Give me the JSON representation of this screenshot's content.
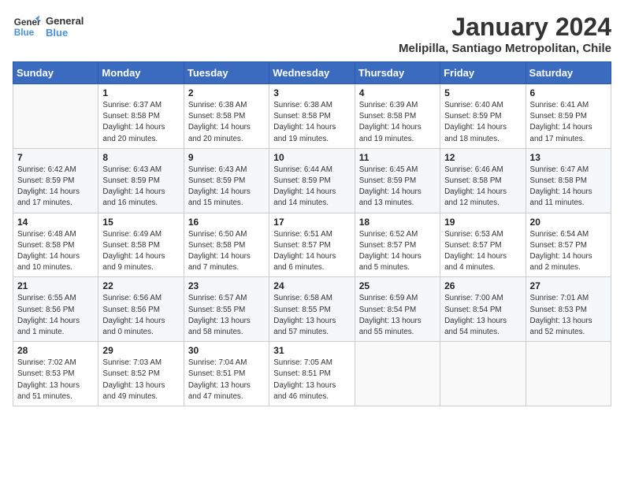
{
  "header": {
    "logo_general": "General",
    "logo_blue": "Blue",
    "month_title": "January 2024",
    "location": "Melipilla, Santiago Metropolitan, Chile"
  },
  "weekdays": [
    "Sunday",
    "Monday",
    "Tuesday",
    "Wednesday",
    "Thursday",
    "Friday",
    "Saturday"
  ],
  "weeks": [
    [
      {
        "day": "",
        "info": ""
      },
      {
        "day": "1",
        "info": "Sunrise: 6:37 AM\nSunset: 8:58 PM\nDaylight: 14 hours\nand 20 minutes."
      },
      {
        "day": "2",
        "info": "Sunrise: 6:38 AM\nSunset: 8:58 PM\nDaylight: 14 hours\nand 20 minutes."
      },
      {
        "day": "3",
        "info": "Sunrise: 6:38 AM\nSunset: 8:58 PM\nDaylight: 14 hours\nand 19 minutes."
      },
      {
        "day": "4",
        "info": "Sunrise: 6:39 AM\nSunset: 8:58 PM\nDaylight: 14 hours\nand 19 minutes."
      },
      {
        "day": "5",
        "info": "Sunrise: 6:40 AM\nSunset: 8:59 PM\nDaylight: 14 hours\nand 18 minutes."
      },
      {
        "day": "6",
        "info": "Sunrise: 6:41 AM\nSunset: 8:59 PM\nDaylight: 14 hours\nand 17 minutes."
      }
    ],
    [
      {
        "day": "7",
        "info": "Sunrise: 6:42 AM\nSunset: 8:59 PM\nDaylight: 14 hours\nand 17 minutes."
      },
      {
        "day": "8",
        "info": "Sunrise: 6:43 AM\nSunset: 8:59 PM\nDaylight: 14 hours\nand 16 minutes."
      },
      {
        "day": "9",
        "info": "Sunrise: 6:43 AM\nSunset: 8:59 PM\nDaylight: 14 hours\nand 15 minutes."
      },
      {
        "day": "10",
        "info": "Sunrise: 6:44 AM\nSunset: 8:59 PM\nDaylight: 14 hours\nand 14 minutes."
      },
      {
        "day": "11",
        "info": "Sunrise: 6:45 AM\nSunset: 8:59 PM\nDaylight: 14 hours\nand 13 minutes."
      },
      {
        "day": "12",
        "info": "Sunrise: 6:46 AM\nSunset: 8:58 PM\nDaylight: 14 hours\nand 12 minutes."
      },
      {
        "day": "13",
        "info": "Sunrise: 6:47 AM\nSunset: 8:58 PM\nDaylight: 14 hours\nand 11 minutes."
      }
    ],
    [
      {
        "day": "14",
        "info": "Sunrise: 6:48 AM\nSunset: 8:58 PM\nDaylight: 14 hours\nand 10 minutes."
      },
      {
        "day": "15",
        "info": "Sunrise: 6:49 AM\nSunset: 8:58 PM\nDaylight: 14 hours\nand 9 minutes."
      },
      {
        "day": "16",
        "info": "Sunrise: 6:50 AM\nSunset: 8:58 PM\nDaylight: 14 hours\nand 7 minutes."
      },
      {
        "day": "17",
        "info": "Sunrise: 6:51 AM\nSunset: 8:57 PM\nDaylight: 14 hours\nand 6 minutes."
      },
      {
        "day": "18",
        "info": "Sunrise: 6:52 AM\nSunset: 8:57 PM\nDaylight: 14 hours\nand 5 minutes."
      },
      {
        "day": "19",
        "info": "Sunrise: 6:53 AM\nSunset: 8:57 PM\nDaylight: 14 hours\nand 4 minutes."
      },
      {
        "day": "20",
        "info": "Sunrise: 6:54 AM\nSunset: 8:57 PM\nDaylight: 14 hours\nand 2 minutes."
      }
    ],
    [
      {
        "day": "21",
        "info": "Sunrise: 6:55 AM\nSunset: 8:56 PM\nDaylight: 14 hours\nand 1 minute."
      },
      {
        "day": "22",
        "info": "Sunrise: 6:56 AM\nSunset: 8:56 PM\nDaylight: 14 hours\nand 0 minutes."
      },
      {
        "day": "23",
        "info": "Sunrise: 6:57 AM\nSunset: 8:55 PM\nDaylight: 13 hours\nand 58 minutes."
      },
      {
        "day": "24",
        "info": "Sunrise: 6:58 AM\nSunset: 8:55 PM\nDaylight: 13 hours\nand 57 minutes."
      },
      {
        "day": "25",
        "info": "Sunrise: 6:59 AM\nSunset: 8:54 PM\nDaylight: 13 hours\nand 55 minutes."
      },
      {
        "day": "26",
        "info": "Sunrise: 7:00 AM\nSunset: 8:54 PM\nDaylight: 13 hours\nand 54 minutes."
      },
      {
        "day": "27",
        "info": "Sunrise: 7:01 AM\nSunset: 8:53 PM\nDaylight: 13 hours\nand 52 minutes."
      }
    ],
    [
      {
        "day": "28",
        "info": "Sunrise: 7:02 AM\nSunset: 8:53 PM\nDaylight: 13 hours\nand 51 minutes."
      },
      {
        "day": "29",
        "info": "Sunrise: 7:03 AM\nSunset: 8:52 PM\nDaylight: 13 hours\nand 49 minutes."
      },
      {
        "day": "30",
        "info": "Sunrise: 7:04 AM\nSunset: 8:51 PM\nDaylight: 13 hours\nand 47 minutes."
      },
      {
        "day": "31",
        "info": "Sunrise: 7:05 AM\nSunset: 8:51 PM\nDaylight: 13 hours\nand 46 minutes."
      },
      {
        "day": "",
        "info": ""
      },
      {
        "day": "",
        "info": ""
      },
      {
        "day": "",
        "info": ""
      }
    ]
  ]
}
